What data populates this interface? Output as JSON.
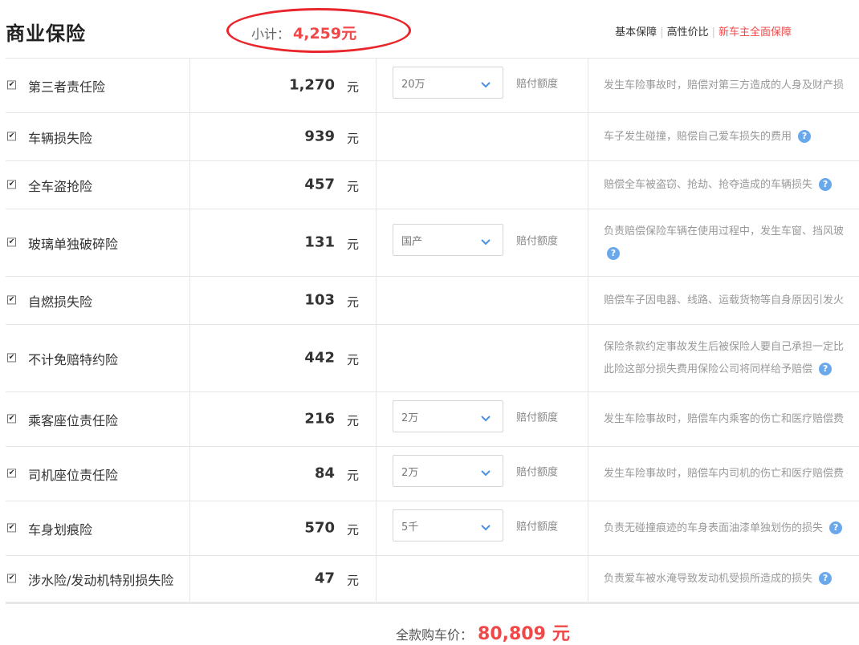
{
  "header": {
    "title": "商业保险",
    "subtotal_label": "小计：",
    "subtotal_value": "4,259元",
    "plans": [
      "基本保障",
      "高性价比",
      "新车主全面保障"
    ]
  },
  "colors": {
    "accent_red": "#f04848",
    "help_icon_blue": "#6aa8ec"
  },
  "rows": [
    {
      "checked": true,
      "name": "第三者责任险",
      "price": "1,270",
      "unit": "元",
      "select": "20万",
      "coverage_label": "赔付额度",
      "desc": [
        "发生车险事故时，赔偿对第三方造成的人身及财产损"
      ],
      "help": false
    },
    {
      "checked": true,
      "name": "车辆损失险",
      "price": "939",
      "unit": "元",
      "select": null,
      "desc": [
        "车子发生碰撞，赔偿自己爱车损失的费用"
      ],
      "help": true
    },
    {
      "checked": true,
      "name": "全车盗抢险",
      "price": "457",
      "unit": "元",
      "select": null,
      "desc": [
        "赔偿全车被盗窃、抢劫、抢夺造成的车辆损失"
      ],
      "help": true
    },
    {
      "checked": true,
      "name": "玻璃单独破碎险",
      "price": "131",
      "unit": "元",
      "select": "国产",
      "coverage_label": "赔付额度",
      "desc": [
        "负责赔偿保险车辆在使用过程中，发生车窗、挡风玻"
      ],
      "help": true,
      "help_newline": true
    },
    {
      "checked": true,
      "name": "自燃损失险",
      "price": "103",
      "unit": "元",
      "select": null,
      "desc": [
        "赔偿车子因电器、线路、运载货物等自身原因引发火"
      ],
      "help": false
    },
    {
      "checked": true,
      "name": "不计免赔特约险",
      "price": "442",
      "unit": "元",
      "select": null,
      "desc": [
        "保险条款约定事故发生后被保险人要自己承担一定比",
        "此险这部分损失费用保险公司将同样给予赔偿"
      ],
      "help": true
    },
    {
      "checked": true,
      "name": "乘客座位责任险",
      "price": "216",
      "unit": "元",
      "select": "2万",
      "coverage_label": "赔付额度",
      "desc": [
        "发生车险事故时，赔偿车内乘客的伤亡和医疗赔偿费"
      ],
      "help": false
    },
    {
      "checked": true,
      "name": "司机座位责任险",
      "price": "84",
      "unit": "元",
      "select": "2万",
      "coverage_label": "赔付额度",
      "desc": [
        "发生车险事故时，赔偿车内司机的伤亡和医疗赔偿费"
      ],
      "help": false
    },
    {
      "checked": true,
      "name": "车身划痕险",
      "price": "570",
      "unit": "元",
      "select": "5千",
      "coverage_label": "赔付额度",
      "desc": [
        "负责无碰撞痕迹的车身表面油漆单独划伤的损失"
      ],
      "help": true
    },
    {
      "checked": true,
      "name": "涉水险/发动机特别损失险",
      "price": "47",
      "unit": "元",
      "select": null,
      "desc": [
        "负责爱车被水淹导致发动机受损所造成的损失"
      ],
      "help": true
    }
  ],
  "footer": {
    "total_label": "全款购车价：",
    "total_value": "80,809",
    "total_unit": "元"
  }
}
